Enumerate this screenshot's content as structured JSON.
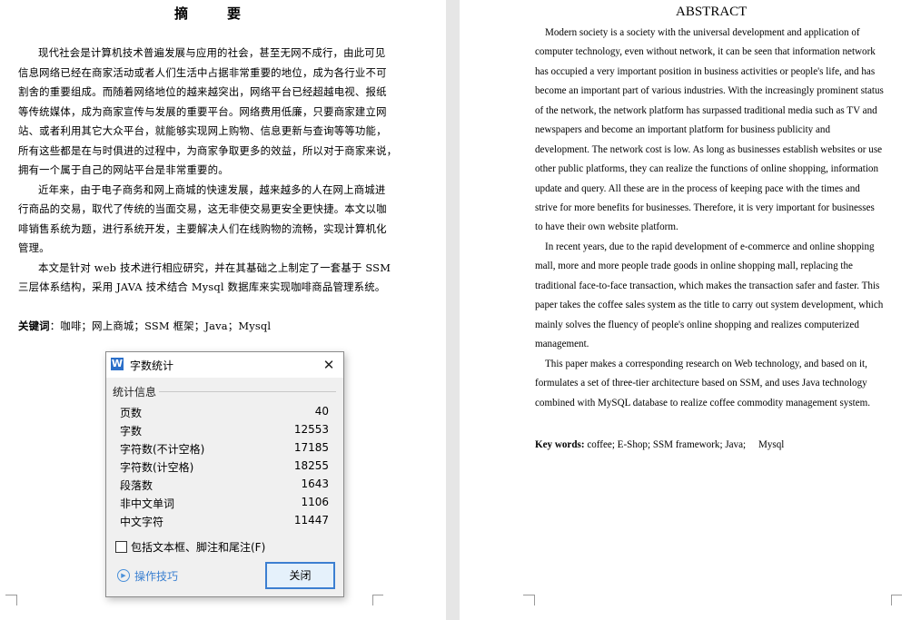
{
  "left_page": {
    "title": "摘　要",
    "lines": [
      "现代社会是计算机技术普遍发展与应用的社会，甚至无网不成行，由此可见",
      "信息网络已经在商家活动或者人们生活中占据非常重要的地位，成为各行业不可",
      "割舍的重要组成。而随着网络地位的越来越突出，网络平台已经超越电视、报纸",
      "等传统媒体，成为商家宣传与发展的重要平台。网络费用低廉，只要商家建立网",
      "站、或者利用其它大众平台，就能够实现网上购物、信息更新与查询等等功能，",
      "所有这些都是在与时俱进的过程中，为商家争取更多的效益，所以对于商家来说，",
      "拥有一个属于自己的网站平台是非常重要的。",
      "近年来，由于电子商务和网上商城的快速发展，越来越多的人在网上商城进",
      "行商品的交易，取代了传统的当面交易，这无非使交易更安全更快捷。本文以咖",
      "啡销售系统为题，进行系统开发，主要解决人们在线购物的流畅，实现计算机化",
      "管理。",
      "本文是针对 web 技术进行相应研究，并在其基础之上制定了一套基于 SSM",
      "三层体系结构，采用 JAVA 技术结合 Mysql 数据库来实现咖啡商品管理系统。"
    ],
    "keywords_label": "关键词",
    "keywords_text": "：咖啡；网上商城；SSM 框架；Java；Mysql"
  },
  "right_page": {
    "title": "ABSTRACT",
    "lines": [
      "Modern society is a society with the universal development and application of",
      "computer technology, even without network, it can be seen that information network",
      "has occupied a very important position in business activities or people's life, and has",
      "become an important part of various industries. With the increasingly prominent status",
      "of the network, the network platform has surpassed traditional media such as TV and",
      "newspapers and become an important platform for business publicity and",
      "development. The network cost is low. As long as businesses establish websites or use",
      "other public platforms, they can realize the functions of online shopping, information",
      "update and query. All these are in the process of keeping pace with the times and",
      "strive for more benefits for businesses. Therefore, it is very important for businesses",
      "to have their own website platform.",
      "In recent years, due to the rapid development of e-commerce and online shopping",
      "mall, more and more people trade goods in online shopping mall, replacing the",
      "traditional face-to-face transaction, which makes the transaction safer and faster. This",
      "paper takes the coffee sales system as the title to carry out system development, which",
      "mainly solves the fluency of people's online shopping and realizes computerized",
      "management.",
      "This paper makes a corresponding research on Web technology, and based on it,",
      "formulates a set of three-tier architecture based on SSM, and uses Java technology",
      "combined with MySQL database to realize coffee commodity management system."
    ],
    "keywords_label": "Key words:",
    "keywords_text": " coffee; E-Shop; SSM framework; Java;　 Mysql"
  },
  "dialog": {
    "app_icon": "W",
    "title": "字数统计",
    "group_label": "统计信息",
    "rows": [
      {
        "label": "页数",
        "value": "40"
      },
      {
        "label": "字数",
        "value": "12553"
      },
      {
        "label": "字符数(不计空格)",
        "value": "17185"
      },
      {
        "label": "字符数(计空格)",
        "value": "18255"
      },
      {
        "label": "段落数",
        "value": "1643"
      },
      {
        "label": "非中文单词",
        "value": "1106"
      },
      {
        "label": "中文字符",
        "value": "11447"
      }
    ],
    "checkbox_label": "包括文本框、脚注和尾注(F)",
    "checkbox_checked": false,
    "tips_label": "操作技巧",
    "close_label": "关闭",
    "close_icon": "close-icon",
    "tips_icon": "play-circle-icon"
  }
}
